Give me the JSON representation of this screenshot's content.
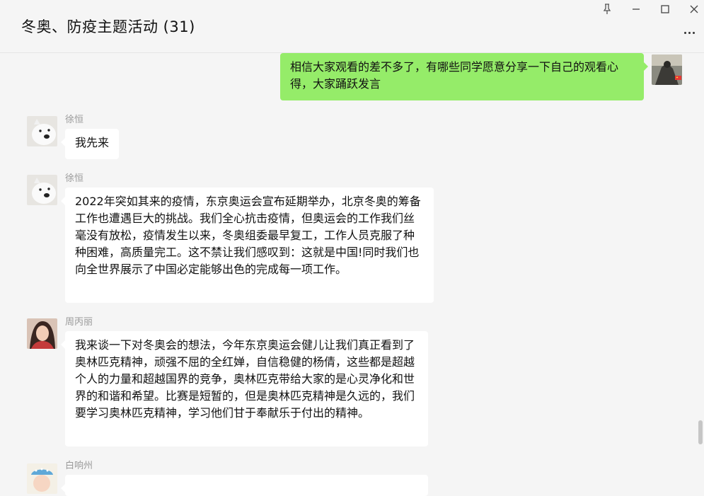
{
  "window": {
    "title": "冬奥、防疫主题活动 (31)",
    "pin_icon": "pin-icon",
    "minimize_icon": "minimize-icon",
    "maximize_icon": "maximize-icon",
    "close_icon": "close-icon",
    "more_icon": "more-icon"
  },
  "messages": [
    {
      "self": true,
      "text": "相信大家观看的差不多了，有哪些同学愿意分享一下自己的观看心得，大家踊跃发言"
    },
    {
      "sender": "徐恒",
      "text": "我先来"
    },
    {
      "sender": "徐恒",
      "text": "2022年突如其来的疫情，东京奥运会宣布延期举办，北京冬奥的筹备工作也遭遇巨大的挑战。我们全心抗击疫情，但奥运会的工作我们丝毫没有放松，疫情发生以来，冬奥组委最早复工，工作人员克服了种种困难，高质量完工。这不禁让我们感叹到：这就是中国!同时我们也向全世界展示了中国必定能够出色的完成每一项工作。"
    },
    {
      "sender": "周丙丽",
      "text": "我来谈一下对冬奥会的想法，今年东京奥运会健儿让我们真正看到了奥林匹克精神，顽强不屈的全红婵，自信稳健的杨倩，这些都是超越个人的力量和超越国界的竞争，奥林匹克带给大家的是心灵净化和世界的和谐和希望。比赛是短暂的，但是奥林匹克精神是久远的，我们要学习奥林匹克精神，学习他们甘于奉献乐于付出的精神。"
    },
    {
      "sender": "白响州",
      "text": ""
    }
  ]
}
